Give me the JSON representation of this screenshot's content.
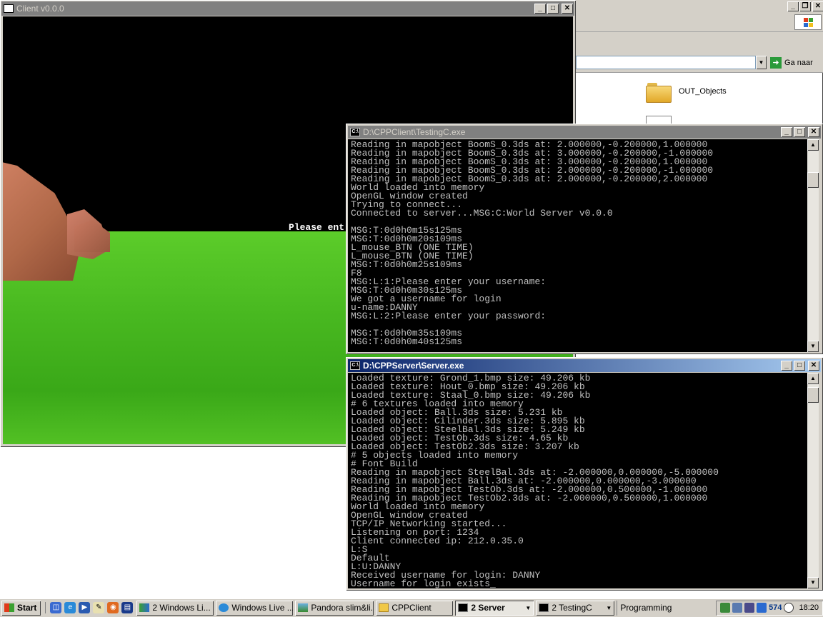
{
  "explorer": {
    "go_label": "Ga naar",
    "folder_label": "OUT_Objects"
  },
  "client_window": {
    "title": "Client v0.0.0",
    "prompt": "Please ent"
  },
  "testing_window": {
    "title": "D:\\CPPClient\\TestingC.exe",
    "lines": [
      "Reading in mapobject BoomS_0.3ds at: 2.000000,-0.200000,1.000000",
      "Reading in mapobject BoomS_0.3ds at: 3.000000,-0.200000,-1.000000",
      "Reading in mapobject BoomS_0.3ds at: 3.000000,-0.200000,1.000000",
      "Reading in mapobject BoomS_0.3ds at: 2.000000,-0.200000,-1.000000",
      "Reading in mapobject BoomS_0.3ds at: 2.000000,-0.200000,2.000000",
      "World loaded into memory",
      "OpenGL window created",
      "Trying to connect...",
      "Connected to server...MSG:C:World Server v0.0.0",
      "",
      "MSG:T:0d0h0m15s125ms",
      "MSG:T:0d0h0m20s109ms",
      "L_mouse_BTN (ONE TIME)",
      "L_mouse_BTN (ONE TIME)",
      "MSG:T:0d0h0m25s109ms",
      "F8",
      "MSG:L:1:Please enter your username:",
      "MSG:T:0d0h0m30s125ms",
      "We got a username for login",
      "u-name:DANNY",
      "MSG:L:2:Please enter your password:",
      "",
      "MSG:T:0d0h0m35s109ms",
      "MSG:T:0d0h0m40s125ms"
    ]
  },
  "server_window": {
    "title": "D:\\CPPServer\\Server.exe",
    "lines": [
      "Loaded texture: Grond_1.bmp size: 49.206 kb",
      "Loaded texture: Hout_0.bmp size: 49.206 kb",
      "Loaded texture: Staal_0.bmp size: 49.206 kb",
      "# 6 textures loaded into memory",
      "Loaded object: Ball.3ds size: 5.231 kb",
      "Loaded object: Cilinder.3ds size: 5.895 kb",
      "Loaded object: SteelBal.3ds size: 5.249 kb",
      "Loaded object: TestOb.3ds size: 4.65 kb",
      "Loaded object: TestOb2.3ds size: 3.207 kb",
      "# 5 objects loaded into memory",
      "# Font Build",
      "Reading in mapobject SteelBal.3ds at: -2.000000,0.000000,-5.000000",
      "Reading in mapobject Ball.3ds at: -2.000000,0.000000,-3.000000",
      "Reading in mapobject TestOb.3ds at: -2.000000,0.500000,-1.000000",
      "Reading in mapobject TestOb2.3ds at: -2.000000,0.500000,1.000000",
      "World loaded into memory",
      "OpenGL window created",
      "TCP/IP Networking started...",
      "Listening on port: 1234",
      "Client connected ip: 212.0.35.0",
      "L:S",
      "Default",
      "L:U:DANNY",
      "Received username for login: DANNY",
      "Username for login exists_"
    ]
  },
  "taskbar": {
    "start_label": "Start",
    "tasks": [
      "2 Windows Li...",
      "Windows Live ...",
      "Pandora slim&li...",
      "CPPClient",
      "2 Server",
      "2 TestingC",
      "Programming"
    ],
    "tray_number": "574",
    "clock": "18:20"
  }
}
